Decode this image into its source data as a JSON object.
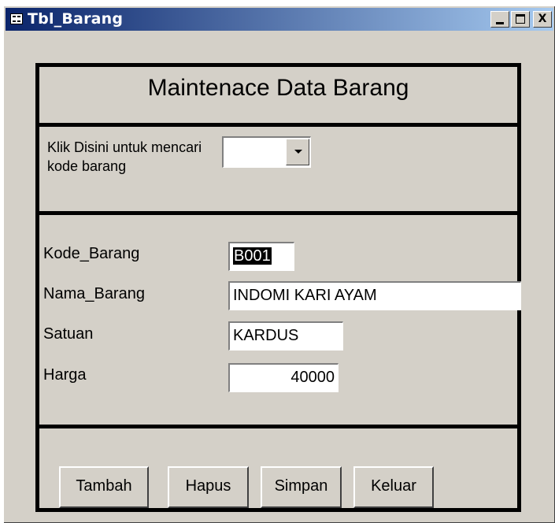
{
  "window": {
    "title": "Tbl_Barang",
    "title_icon": "form-icon",
    "controls": {
      "minimize": "minimize-icon",
      "maximize": "maximize-icon",
      "close_label": "X"
    }
  },
  "form": {
    "title": "Maintenace Data Barang",
    "lookup": {
      "label": "Klik Disini untuk mencari kode barang",
      "value": ""
    },
    "fields": {
      "kode": {
        "label": "Kode_Barang",
        "value": "B001"
      },
      "nama": {
        "label": "Nama_Barang",
        "value": "INDOMI KARI AYAM"
      },
      "satuan": {
        "label": "Satuan",
        "value": "KARDUS"
      },
      "harga": {
        "label": "Harga",
        "value": "40000"
      }
    },
    "buttons": {
      "tambah": "Tambah",
      "hapus": "Hapus",
      "simpan": "Simpan",
      "keluar": "Keluar"
    }
  },
  "colors": {
    "titlebar_start": "#0a246a",
    "titlebar_end": "#a6caf0",
    "window_bg": "#d4d0c8"
  }
}
